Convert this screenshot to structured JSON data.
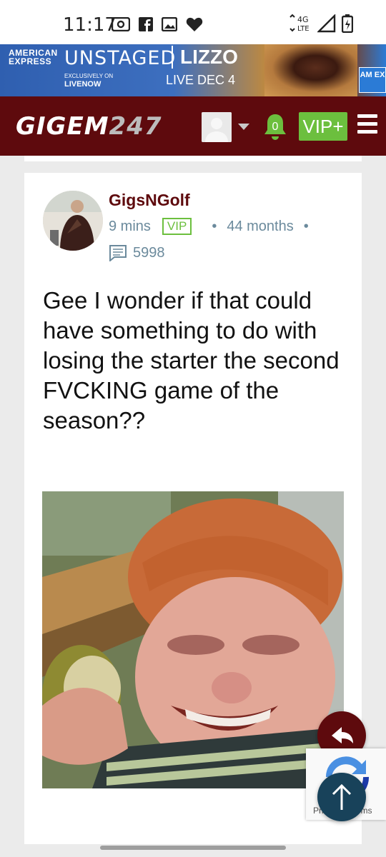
{
  "status_bar": {
    "time": "11:17",
    "network": "4G LTE"
  },
  "ad_banner": {
    "brand_line1": "AMERICAN",
    "brand_line2": "EXPRESS",
    "title": "UNSTAGED",
    "artist": "LIZZO",
    "exclusive_line1": "EXCLUSIVELY ON",
    "exclusive_line2": "LIVENOW",
    "live_date": "LIVE DEC 4",
    "badge": "AM EX"
  },
  "header": {
    "logo_text": "GIGEM",
    "logo_num": "247",
    "notification_count": "0",
    "vip_label": "VIP+"
  },
  "post": {
    "author": "GigsNGolf",
    "time_ago": "9 mins",
    "badge": "VIP",
    "membership": "44 months",
    "post_count": "5998",
    "body": "Gee I wonder if that could have something to do with losing the starter the second FVCKING game of the season??"
  },
  "recaptcha": {
    "links": "Privacy - Terms"
  },
  "colors": {
    "brand": "#5e0a0d",
    "vip_green": "#6cbf3e",
    "meta_gray": "#6b8a9c",
    "scroll_fab": "#18425a"
  }
}
